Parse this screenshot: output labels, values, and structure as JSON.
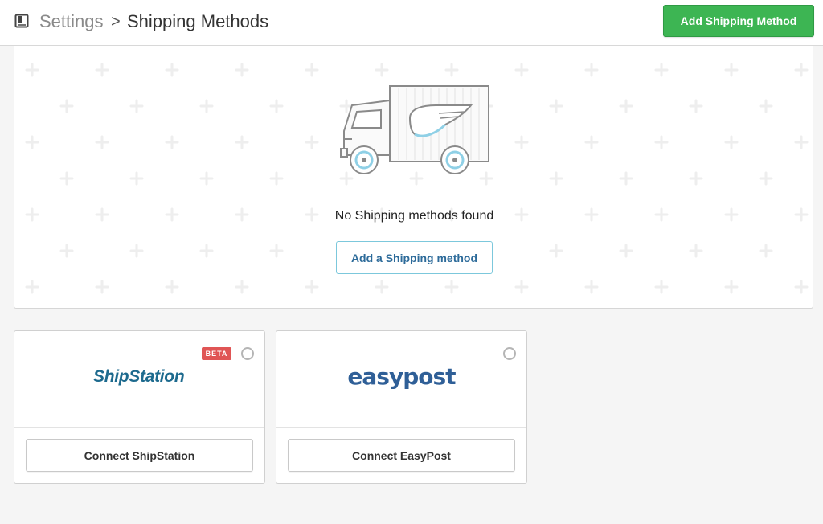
{
  "header": {
    "breadcrumb_parent": "Settings",
    "breadcrumb_separator": ">",
    "title": "Shipping Methods",
    "primary_action": "Add Shipping Method",
    "icon": "book-icon"
  },
  "empty_state": {
    "illustration": "delivery-truck-icon",
    "message": "No Shipping methods found",
    "action": "Add a Shipping method"
  },
  "integrations": [
    {
      "name": "ShipStation",
      "logo_text": "ShipStation",
      "badge": "BETA",
      "selected": false,
      "connect_label": "Connect ShipStation"
    },
    {
      "name": "EasyPost",
      "logo_text": "easypost",
      "badge": "",
      "selected": false,
      "connect_label": "Connect EasyPost"
    }
  ],
  "colors": {
    "primary_green": "#3db553",
    "beta_red": "#e05555",
    "link_blue": "#2d6b9a",
    "easypost_blue": "#2f5f97",
    "shipstation_blue": "#1d6a8e"
  }
}
